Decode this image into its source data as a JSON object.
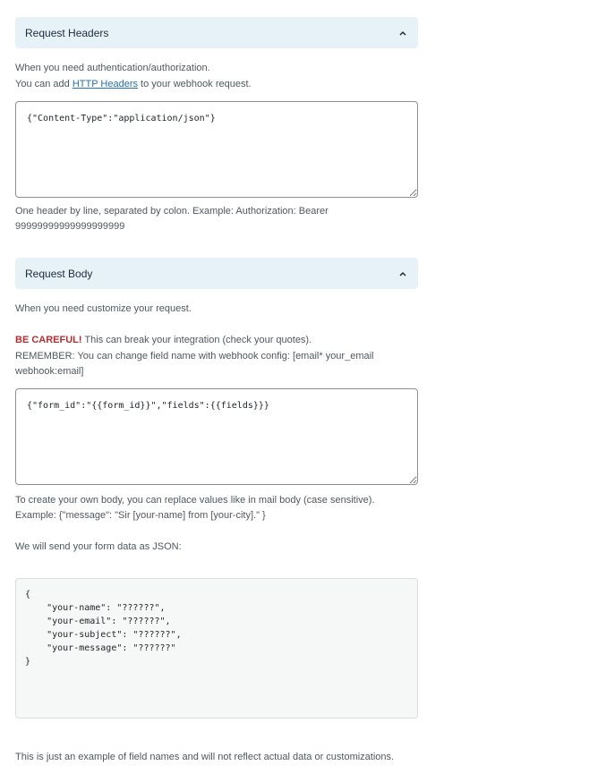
{
  "request_headers": {
    "title": "Request Headers",
    "help_line1": "When you need authentication/authorization.",
    "help_line2_prefix": "You can add ",
    "help_line2_link": "HTTP Headers",
    "help_line2_suffix": " to your webhook request.",
    "value": "{\"Content-Type\":\"application/json\"}",
    "note_line1": "One header by line, separated by colon. Example: Authorization: Bearer",
    "note_line2": "99999999999999999999"
  },
  "request_body": {
    "title": "Request Body",
    "help": "When you need customize your request.",
    "careful_label": "BE CAREFUL!",
    "careful_text": " This can break your integration (check your quotes).",
    "remember_line1": "REMEMBER: You can change field name with webhook config: [email* your_email",
    "remember_line2": "webhook:email]",
    "value": "{\"form_id\":\"{{form_id}}\",\"fields\":{{fields}}}",
    "note_line1": "To create your own body, you can replace values like in mail body (case sensitive).",
    "note_line2": "Example: {\"message\": \"Sir [your-name] from [your-city].\" }"
  },
  "json_preview": {
    "intro": "We will send your form data as JSON:",
    "code": "{\n    \"your-name\": \"??????\",\n    \"your-email\": \"??????\",\n    \"your-subject\": \"??????\",\n    \"your-message\": \"??????\"\n}",
    "footer": "This is just an example of field names and will not reflect actual data or customizations."
  }
}
